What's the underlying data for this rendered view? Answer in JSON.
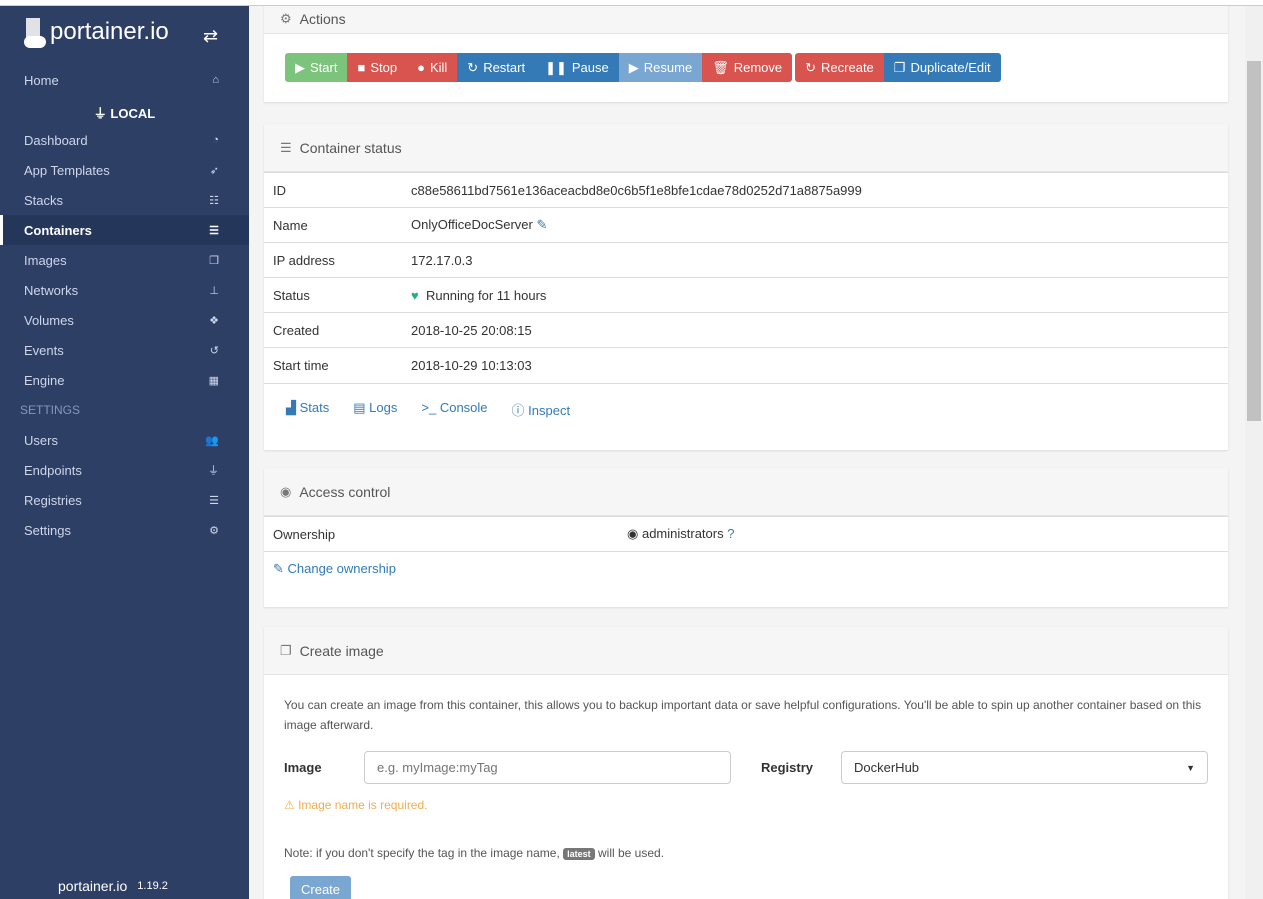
{
  "sidebar": {
    "logo": "portainer.io",
    "home": "Home",
    "endpoint": "LOCAL",
    "items": [
      "Dashboard",
      "App Templates",
      "Stacks",
      "Containers",
      "Images",
      "Networks",
      "Volumes",
      "Events",
      "Engine"
    ],
    "settings_header": "SETTINGS",
    "settings_items": [
      "Users",
      "Endpoints",
      "Registries",
      "Settings"
    ],
    "footer_logo": "portainer.io",
    "version": "1.19.2"
  },
  "actions": {
    "title": "Actions",
    "buttons": [
      "Start",
      "Stop",
      "Kill",
      "Restart",
      "Pause",
      "Resume",
      "Remove",
      "Recreate",
      "Duplicate/Edit"
    ]
  },
  "status": {
    "title": "Container status",
    "rows": [
      [
        "ID",
        "c88e58611bd7561e136aceacbd8e0c6b5f1e8bfe1cdae78d0252d71a8875a999"
      ],
      [
        "Name",
        "OnlyOfficeDocServer"
      ],
      [
        "IP address",
        "172.17.0.3"
      ],
      [
        "Status",
        "Running for 11 hours"
      ],
      [
        "Created",
        "2018-10-25 20:08:15"
      ],
      [
        "Start time",
        "2018-10-29 10:13:03"
      ]
    ],
    "links": [
      "Stats",
      "Logs",
      "Console",
      "Inspect"
    ]
  },
  "access": {
    "title": "Access control",
    "ownership_label": "Ownership",
    "ownership_value": "administrators",
    "change": "Change ownership"
  },
  "create": {
    "title": "Create image",
    "desc": "You can create an image from this container, this allows you to backup important data or save helpful configurations. You'll be able to spin up another container based on this image afterward.",
    "image_label": "Image",
    "image_placeholder": "e.g. myImage:myTag",
    "registry_label": "Registry",
    "registry_value": "DockerHub",
    "warning": "Image name is required.",
    "note_pre": "Note: if you don't specify the tag in the image name,",
    "note_badge": "latest",
    "note_post": "will be used.",
    "button": "Create"
  }
}
